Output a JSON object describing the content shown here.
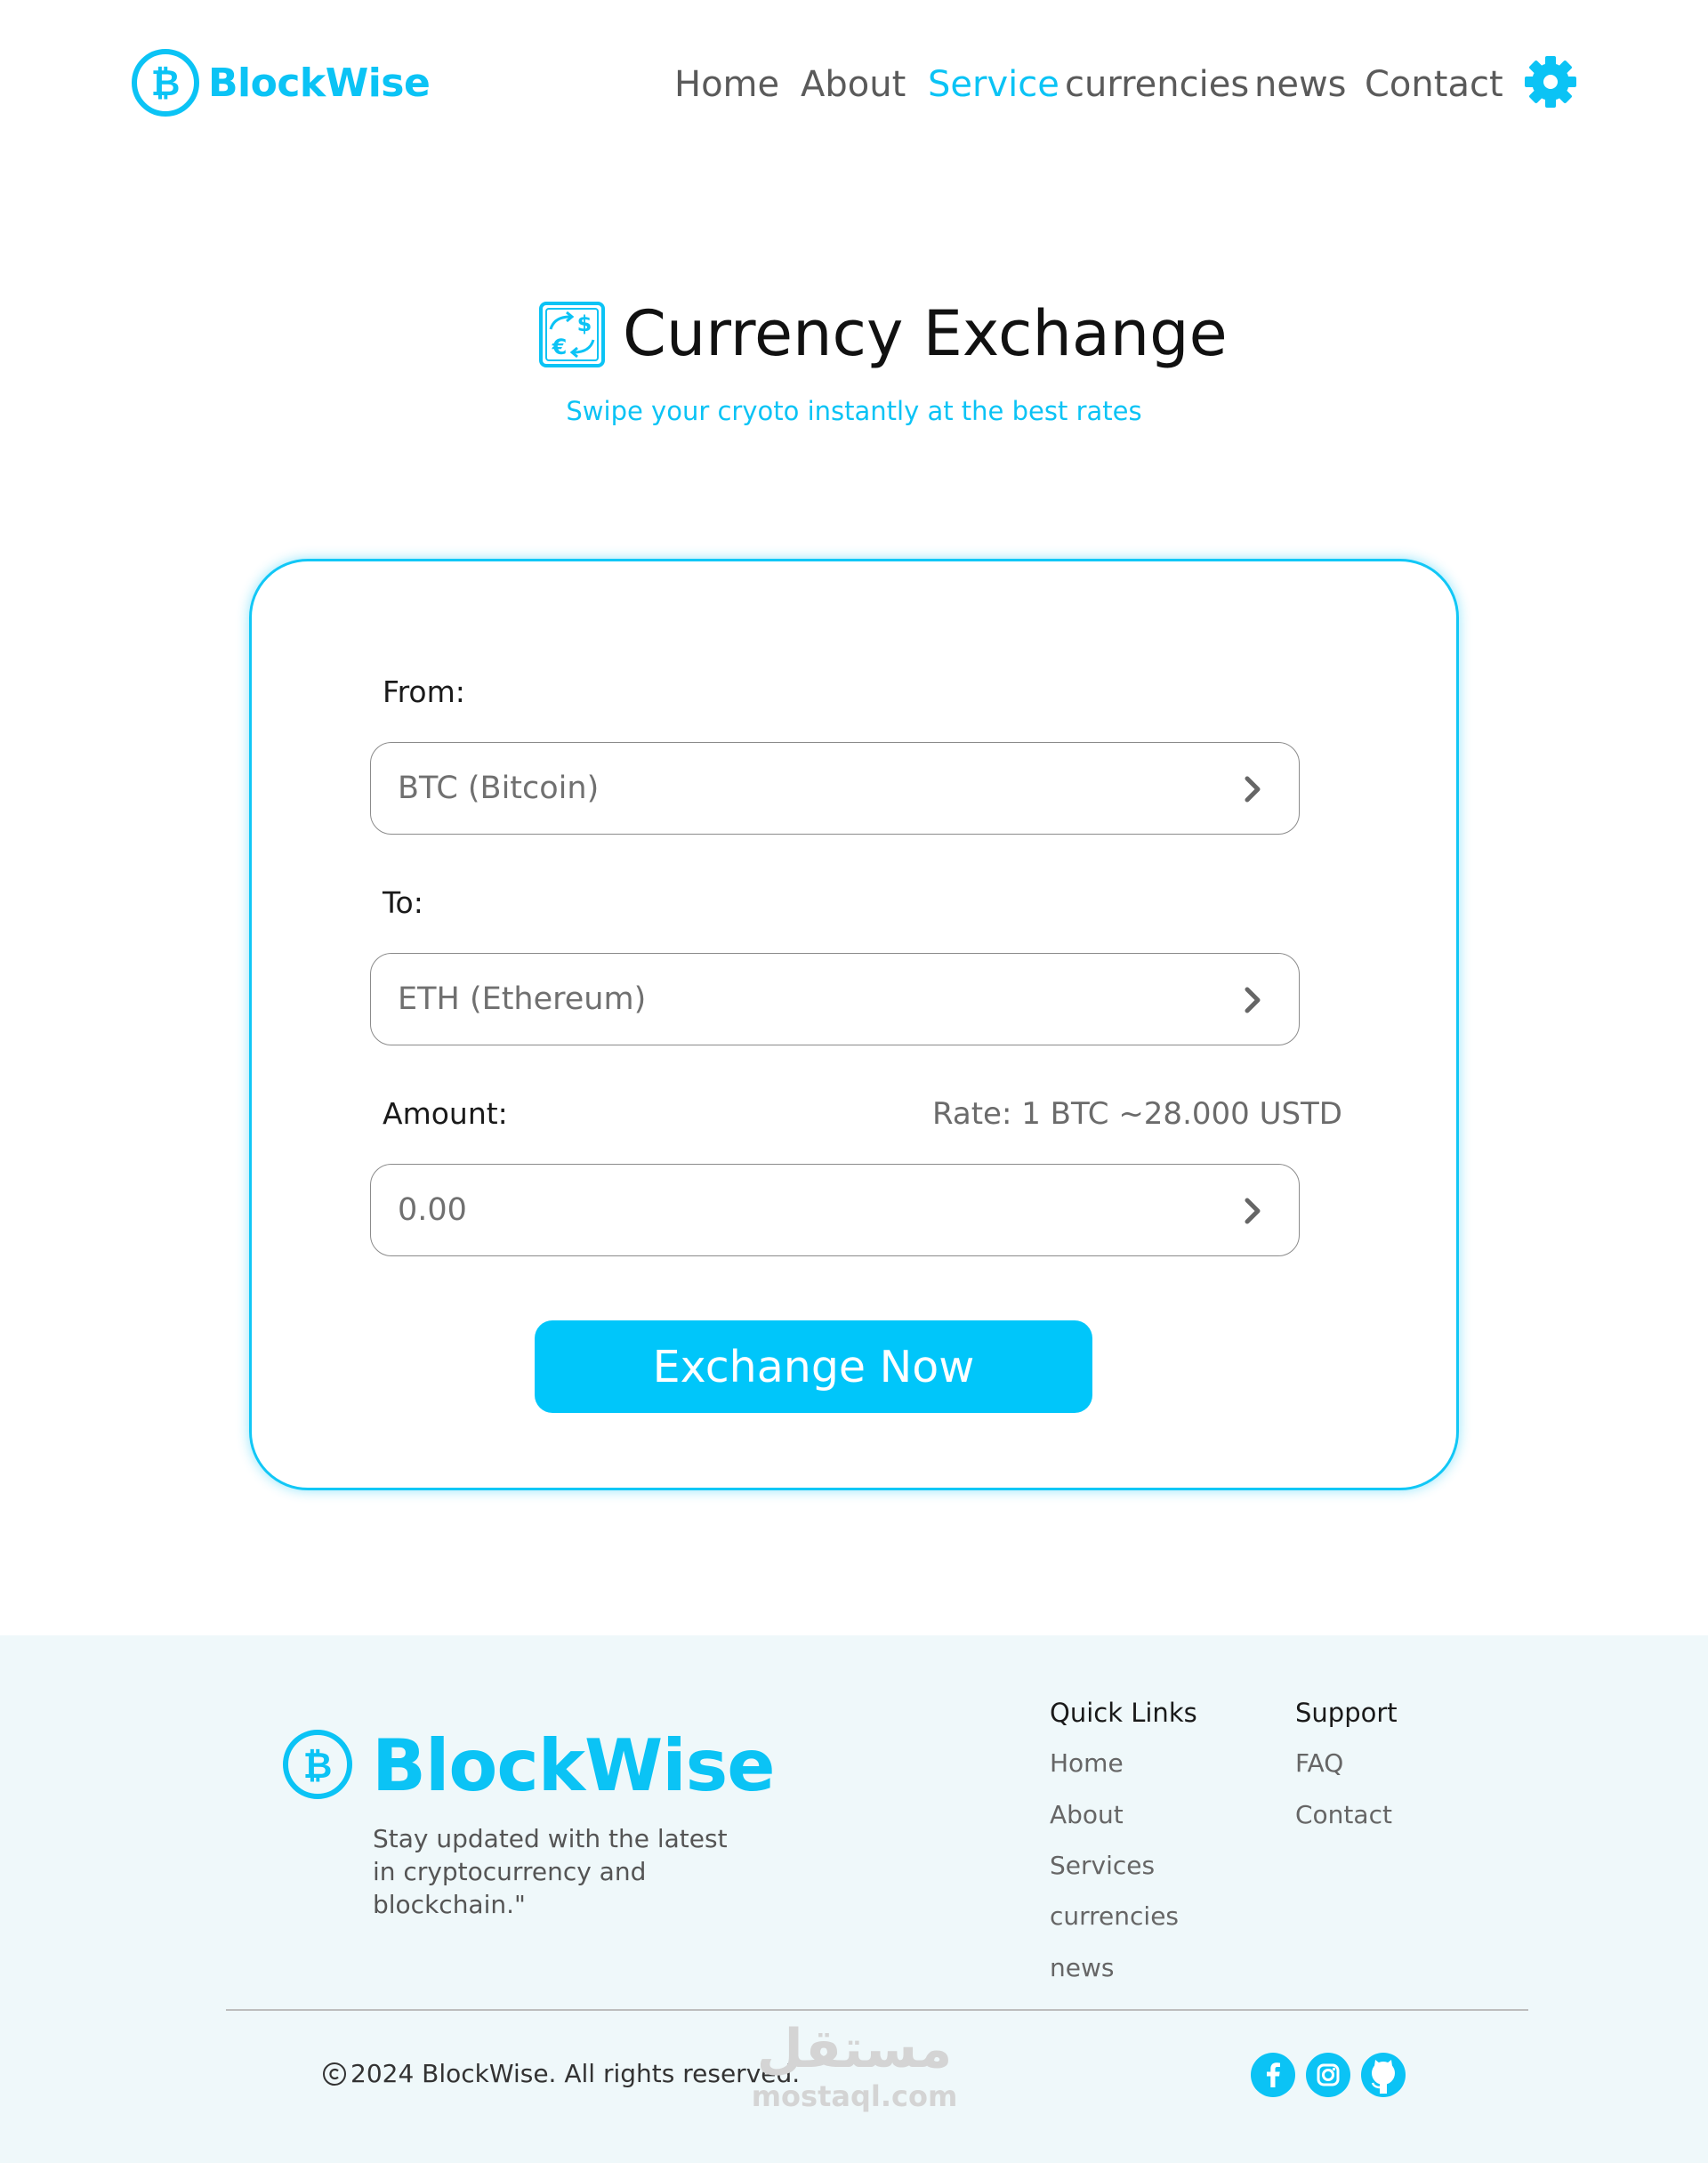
{
  "header": {
    "brand_name": "BlockWise",
    "nav": [
      "Home",
      "About",
      "Service",
      "currencies",
      "news",
      "Contact"
    ],
    "active_nav": "Service"
  },
  "hero": {
    "title": "Currency Exchange",
    "subtitle": "Swipe your cryoto instantly at the best rates"
  },
  "exchange": {
    "from_label": "From:",
    "from_value": "BTC (Bitcoin)",
    "to_label": "To:",
    "to_value": "ETH (Ethereum)",
    "amount_label": "Amount:",
    "rate_text": "Rate: 1 BTC ~28.000 USTD",
    "amount_value": "0.00",
    "button_label": "Exchange Now"
  },
  "footer": {
    "brand_name": "BlockWise",
    "tagline": "Stay updated with the latest in cryptocurrency and blockchain.\"",
    "quick_links_heading": "Quick Links",
    "quick_links": [
      "Home",
      "About",
      "Services",
      "currencies",
      "news"
    ],
    "support_heading": "Support",
    "support_links": [
      "FAQ",
      "Contact"
    ],
    "copyright": "2024 BlockWise. All rights reserved.",
    "watermark_ar": "مستقل",
    "watermark_en": "mostaql.com",
    "social_icons": [
      "facebook-icon",
      "instagram-icon",
      "github-icon"
    ]
  },
  "colors": {
    "accent": "#0bc3f5",
    "button": "#00c6fa",
    "footer_bg": "#eff8fa"
  }
}
